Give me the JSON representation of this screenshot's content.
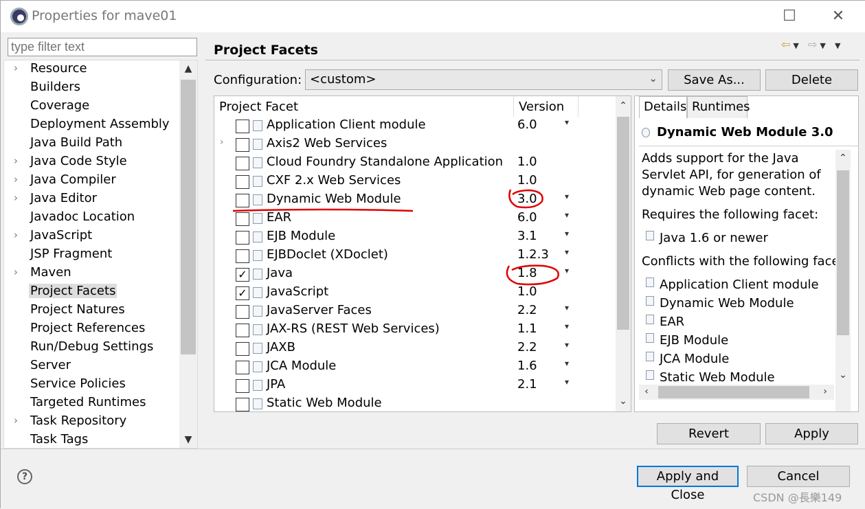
{
  "window": {
    "title": "Properties for mave01",
    "minimize_glyph": "—",
    "maximize_glyph": "☐",
    "close_glyph": "✕"
  },
  "filter": {
    "placeholder": "type filter text"
  },
  "tree": {
    "items": [
      {
        "label": "Resource",
        "expandable": true
      },
      {
        "label": "Builders",
        "expandable": false
      },
      {
        "label": "Coverage",
        "expandable": false
      },
      {
        "label": "Deployment Assembly",
        "expandable": false
      },
      {
        "label": "Java Build Path",
        "expandable": false
      },
      {
        "label": "Java Code Style",
        "expandable": true
      },
      {
        "label": "Java Compiler",
        "expandable": true
      },
      {
        "label": "Java Editor",
        "expandable": true
      },
      {
        "label": "Javadoc Location",
        "expandable": false
      },
      {
        "label": "JavaScript",
        "expandable": true
      },
      {
        "label": "JSP Fragment",
        "expandable": false
      },
      {
        "label": "Maven",
        "expandable": true
      },
      {
        "label": "Project Facets",
        "expandable": false,
        "selected": true
      },
      {
        "label": "Project Natures",
        "expandable": false
      },
      {
        "label": "Project References",
        "expandable": false
      },
      {
        "label": "Run/Debug Settings",
        "expandable": false
      },
      {
        "label": "Server",
        "expandable": false
      },
      {
        "label": "Service Policies",
        "expandable": false
      },
      {
        "label": "Targeted Runtimes",
        "expandable": false
      },
      {
        "label": "Task Repository",
        "expandable": true
      },
      {
        "label": "Task Tags",
        "expandable": false
      }
    ]
  },
  "page": {
    "title": "Project Facets",
    "configuration_label": "Configuration:",
    "configuration_value": "<custom>",
    "save_as_label": "Save As...",
    "delete_label": "Delete"
  },
  "facets": {
    "col_facet": "Project Facet",
    "col_version": "Version",
    "rows": [
      {
        "name": "Application Client module",
        "version": "6.0",
        "checked": false,
        "dropdown": true,
        "expandable": false
      },
      {
        "name": "Axis2 Web Services",
        "version": "",
        "checked": false,
        "dropdown": false,
        "expandable": true
      },
      {
        "name": "Cloud Foundry Standalone Application",
        "version": "1.0",
        "checked": false,
        "dropdown": false,
        "expandable": false
      },
      {
        "name": "CXF 2.x Web Services",
        "version": "1.0",
        "checked": false,
        "dropdown": false,
        "expandable": false
      },
      {
        "name": "Dynamic Web Module",
        "version": "3.0",
        "checked": false,
        "dropdown": true,
        "expandable": false,
        "highlight": true
      },
      {
        "name": "EAR",
        "version": "6.0",
        "checked": false,
        "dropdown": true,
        "expandable": false
      },
      {
        "name": "EJB Module",
        "version": "3.1",
        "checked": false,
        "dropdown": true,
        "expandable": false
      },
      {
        "name": "EJBDoclet (XDoclet)",
        "version": "1.2.3",
        "checked": false,
        "dropdown": true,
        "expandable": false
      },
      {
        "name": "Java",
        "version": "1.8",
        "checked": true,
        "dropdown": true,
        "expandable": false
      },
      {
        "name": "JavaScript",
        "version": "1.0",
        "checked": true,
        "dropdown": false,
        "expandable": false
      },
      {
        "name": "JavaServer Faces",
        "version": "2.2",
        "checked": false,
        "dropdown": true,
        "expandable": false
      },
      {
        "name": "JAX-RS (REST Web Services)",
        "version": "1.1",
        "checked": false,
        "dropdown": true,
        "expandable": false
      },
      {
        "name": "JAXB",
        "version": "2.2",
        "checked": false,
        "dropdown": true,
        "expandable": false
      },
      {
        "name": "JCA Module",
        "version": "1.6",
        "checked": false,
        "dropdown": true,
        "expandable": false
      },
      {
        "name": "JPA",
        "version": "2.1",
        "checked": false,
        "dropdown": true,
        "expandable": false
      },
      {
        "name": "Static Web Module",
        "version": "",
        "checked": false,
        "dropdown": false,
        "expandable": false
      }
    ]
  },
  "details": {
    "tab_details": "Details",
    "tab_runtimes": "Runtimes",
    "title": "Dynamic Web Module 3.0",
    "desc1": "Adds support for the Java",
    "desc2": "Servlet API, for generation of",
    "desc3": "dynamic Web page content.",
    "requires_label": "Requires the following facet:",
    "requires_item": "Java 1.6 or newer",
    "conflicts_label": "Conflicts with the following facet",
    "conflicts": [
      "Application Client module",
      "Dynamic Web Module",
      "EAR",
      "EJB Module",
      "JCA Module",
      "Static Web Module"
    ]
  },
  "actions": {
    "revert_label": "Revert",
    "apply_label": "Apply",
    "apply_close_label": "Apply and Close",
    "cancel_label": "Cancel",
    "help_glyph": "?"
  },
  "watermark": "CSDN @長樂149",
  "colors": {
    "annotation": "#e00000",
    "default_button_border": "#0078d7"
  }
}
